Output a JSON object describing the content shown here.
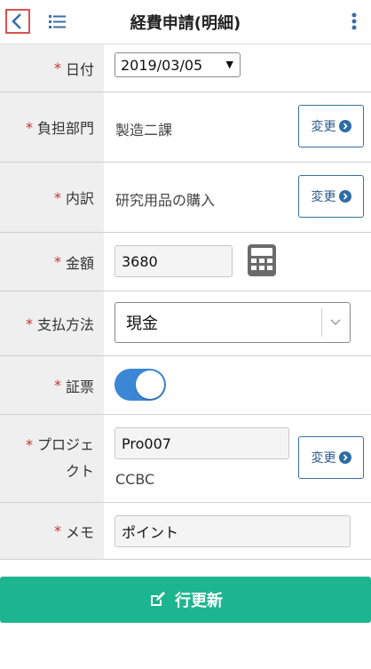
{
  "header": {
    "title": "経費申請(明細)",
    "back_icon": "chevron-left-icon",
    "list_icon": "list-icon",
    "more_icon": "more-vertical-icon"
  },
  "required_mark": "*",
  "form": {
    "date": {
      "label": "日付",
      "value": "2019/03/05"
    },
    "department": {
      "label": "負担部門",
      "value": "製造二課",
      "button": "変更"
    },
    "breakdown": {
      "label": "内訳",
      "value": "研究用品の購入",
      "button": "変更"
    },
    "amount": {
      "label": "金額",
      "value": "3680",
      "icon": "calculator-icon"
    },
    "payment": {
      "label": "支払方法",
      "value": "現金"
    },
    "receipt": {
      "label": "証票",
      "on": true
    },
    "project": {
      "label_line1": "プロジェ",
      "label_line2": "クト",
      "code": "Pro007",
      "name": "CCBC",
      "button": "変更"
    },
    "memo": {
      "label": "メモ",
      "value": "ポイント"
    }
  },
  "footer": {
    "update_label": "行更新",
    "icon": "edit-icon"
  },
  "colors": {
    "accent": "#1db58f",
    "toggle": "#3b87d6",
    "required": "#c9302c",
    "link": "#2e6da4"
  }
}
